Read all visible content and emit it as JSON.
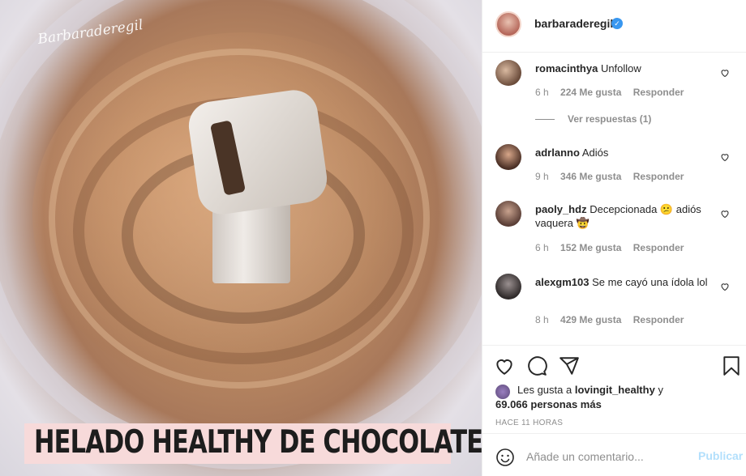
{
  "post": {
    "watermark": "Barbaraderegil",
    "caption_overlay": "HELADO  HEALTHY DE CHOCOLATE"
  },
  "header": {
    "username": "barbaraderegil",
    "verified_icon": "verified-badge-icon",
    "verified_glyph": "✓"
  },
  "comments": [
    {
      "username": "romacinthya",
      "text": "Unfollow",
      "time": "6 h",
      "likes": "224 Me gusta",
      "reply": "Responder",
      "view_replies": "Ver respuestas (1)"
    },
    {
      "username": "adrlanno",
      "text": "Adiós",
      "time": "9 h",
      "likes": "346 Me gusta",
      "reply": "Responder"
    },
    {
      "username": "paoly_hdz",
      "text": "Decepcionada 😕 adiós vaquera 🤠",
      "time": "6 h",
      "likes": "152 Me gusta",
      "reply": "Responder"
    },
    {
      "username": "alexgm103",
      "text": "Se me cayó una ídola lol",
      "time": "8 h",
      "likes": "429 Me gusta",
      "reply": "Responder"
    }
  ],
  "actions": {
    "icons": [
      "heart-icon",
      "comment-icon",
      "share-icon",
      "bookmark-icon"
    ]
  },
  "likes": {
    "prefix": "Les gusta a",
    "user": "lovingit_healthy",
    "suffix": "y",
    "others": "69.066 personas más"
  },
  "timestamp": "HACE 11 HORAS",
  "add_comment": {
    "placeholder": "Añade un comentario...",
    "publish_label": "Publicar"
  },
  "colors": {
    "verified": "#3897f0",
    "muted": "#8e8e8e",
    "publish_disabled": "#b2dffc",
    "caption_bg": "#f7dada"
  }
}
